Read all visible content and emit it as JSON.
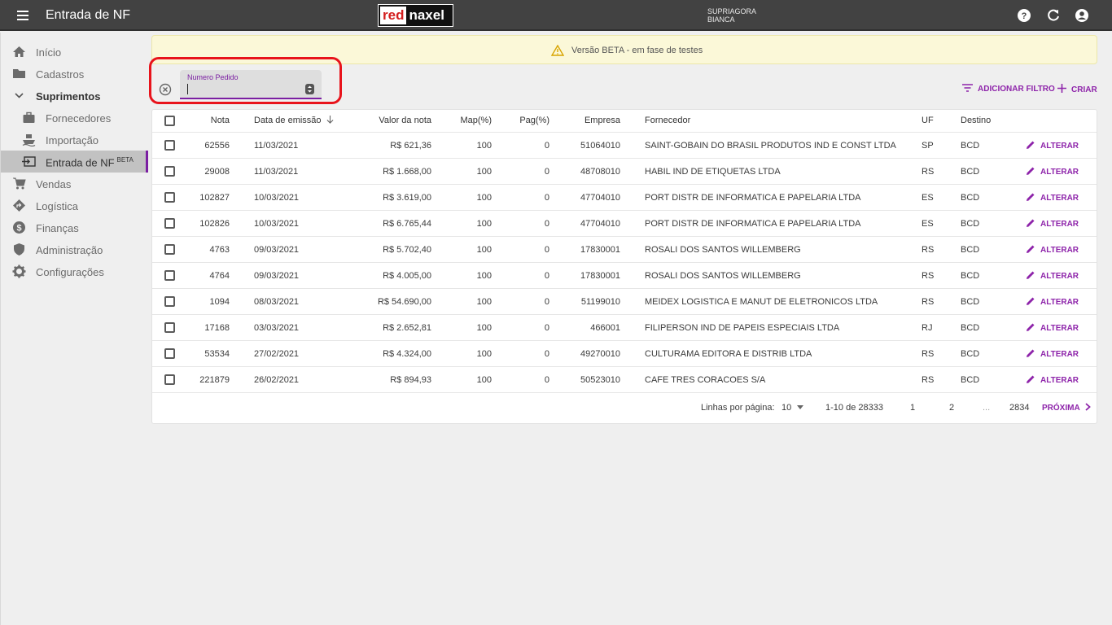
{
  "header": {
    "title": "Entrada de NF",
    "logo_red": "red",
    "logo_white": "naxel",
    "company": "SUPRIAGORA",
    "user": "BIANCA",
    "icons": [
      "help-icon",
      "refresh-icon",
      "account-icon"
    ]
  },
  "sidebar": {
    "items": [
      {
        "label": "Início",
        "icon": "home-icon"
      },
      {
        "label": "Cadastros",
        "icon": "folder-icon"
      },
      {
        "label": "Suprimentos",
        "icon": "chevron-down-icon"
      },
      {
        "label": "Fornecedores",
        "icon": "briefcase-icon"
      },
      {
        "label": "Importação",
        "icon": "ship-icon"
      },
      {
        "label": "Entrada de NF",
        "badge": "BETA",
        "icon": "input-icon"
      },
      {
        "label": "Vendas",
        "icon": "cart-icon"
      },
      {
        "label": "Logística",
        "icon": "directions-icon"
      },
      {
        "label": "Finanças",
        "icon": "dollar-icon"
      },
      {
        "label": "Administração",
        "icon": "shield-icon"
      },
      {
        "label": "Configurações",
        "icon": "gear-icon"
      }
    ]
  },
  "banner": {
    "text": "Versão BETA - em fase de testes"
  },
  "filter": {
    "label": "Numero Pedido",
    "value": ""
  },
  "actions": {
    "add_filter": "ADICIONAR FILTRO",
    "create": "CRIAR"
  },
  "table": {
    "columns": [
      "Nota",
      "Data de emissão",
      "Valor da nota",
      "Map(%)",
      "Pag(%)",
      "Empresa",
      "Fornecedor",
      "UF",
      "Destino"
    ],
    "action_label": "ALTERAR",
    "rows": [
      {
        "nota": "62556",
        "data": "11/03/2021",
        "valor": "R$ 621,36",
        "map": "100",
        "pag": "0",
        "empresa": "51064010",
        "fornecedor": "SAINT-GOBAIN DO BRASIL PRODUTOS IND E CONST LTDA",
        "uf": "SP",
        "destino": "BCD"
      },
      {
        "nota": "29008",
        "data": "11/03/2021",
        "valor": "R$ 1.668,00",
        "map": "100",
        "pag": "0",
        "empresa": "48708010",
        "fornecedor": "HABIL IND DE ETIQUETAS LTDA",
        "uf": "RS",
        "destino": "BCD"
      },
      {
        "nota": "102827",
        "data": "10/03/2021",
        "valor": "R$ 3.619,00",
        "map": "100",
        "pag": "0",
        "empresa": "47704010",
        "fornecedor": "PORT DISTR DE INFORMATICA E PAPELARIA LTDA",
        "uf": "ES",
        "destino": "BCD"
      },
      {
        "nota": "102826",
        "data": "10/03/2021",
        "valor": "R$ 6.765,44",
        "map": "100",
        "pag": "0",
        "empresa": "47704010",
        "fornecedor": "PORT DISTR DE INFORMATICA E PAPELARIA LTDA",
        "uf": "ES",
        "destino": "BCD"
      },
      {
        "nota": "4763",
        "data": "09/03/2021",
        "valor": "R$ 5.702,40",
        "map": "100",
        "pag": "0",
        "empresa": "17830001",
        "fornecedor": "ROSALI DOS SANTOS WILLEMBERG",
        "uf": "RS",
        "destino": "BCD"
      },
      {
        "nota": "4764",
        "data": "09/03/2021",
        "valor": "R$ 4.005,00",
        "map": "100",
        "pag": "0",
        "empresa": "17830001",
        "fornecedor": "ROSALI DOS SANTOS WILLEMBERG",
        "uf": "RS",
        "destino": "BCD"
      },
      {
        "nota": "1094",
        "data": "08/03/2021",
        "valor": "R$ 54.690,00",
        "map": "100",
        "pag": "0",
        "empresa": "51199010",
        "fornecedor": "MEIDEX LOGISTICA E MANUT DE ELETRONICOS LTDA",
        "uf": "RS",
        "destino": "BCD"
      },
      {
        "nota": "17168",
        "data": "03/03/2021",
        "valor": "R$ 2.652,81",
        "map": "100",
        "pag": "0",
        "empresa": "466001",
        "fornecedor": "FILIPERSON IND DE PAPEIS ESPECIAIS LTDA",
        "uf": "RJ",
        "destino": "BCD"
      },
      {
        "nota": "53534",
        "data": "27/02/2021",
        "valor": "R$ 4.324,00",
        "map": "100",
        "pag": "0",
        "empresa": "49270010",
        "fornecedor": "CULTURAMA EDITORA E DISTRIB LTDA",
        "uf": "RS",
        "destino": "BCD"
      },
      {
        "nota": "221879",
        "data": "26/02/2021",
        "valor": "R$ 894,93",
        "map": "100",
        "pag": "0",
        "empresa": "50523010",
        "fornecedor": "CAFE TRES CORACOES S/A",
        "uf": "RS",
        "destino": "BCD"
      }
    ]
  },
  "pagination": {
    "rows_per_page_label": "Linhas por página:",
    "rows_per_page": "10",
    "range": "1-10 de 28333",
    "pages": [
      "1",
      "2",
      "...",
      "2834"
    ],
    "next": "PRÓXIMA"
  },
  "colors": {
    "accent": "#8e24aa",
    "appbar": "#424242",
    "highlight": "#e8131b",
    "banner": "#fbf8d8"
  }
}
